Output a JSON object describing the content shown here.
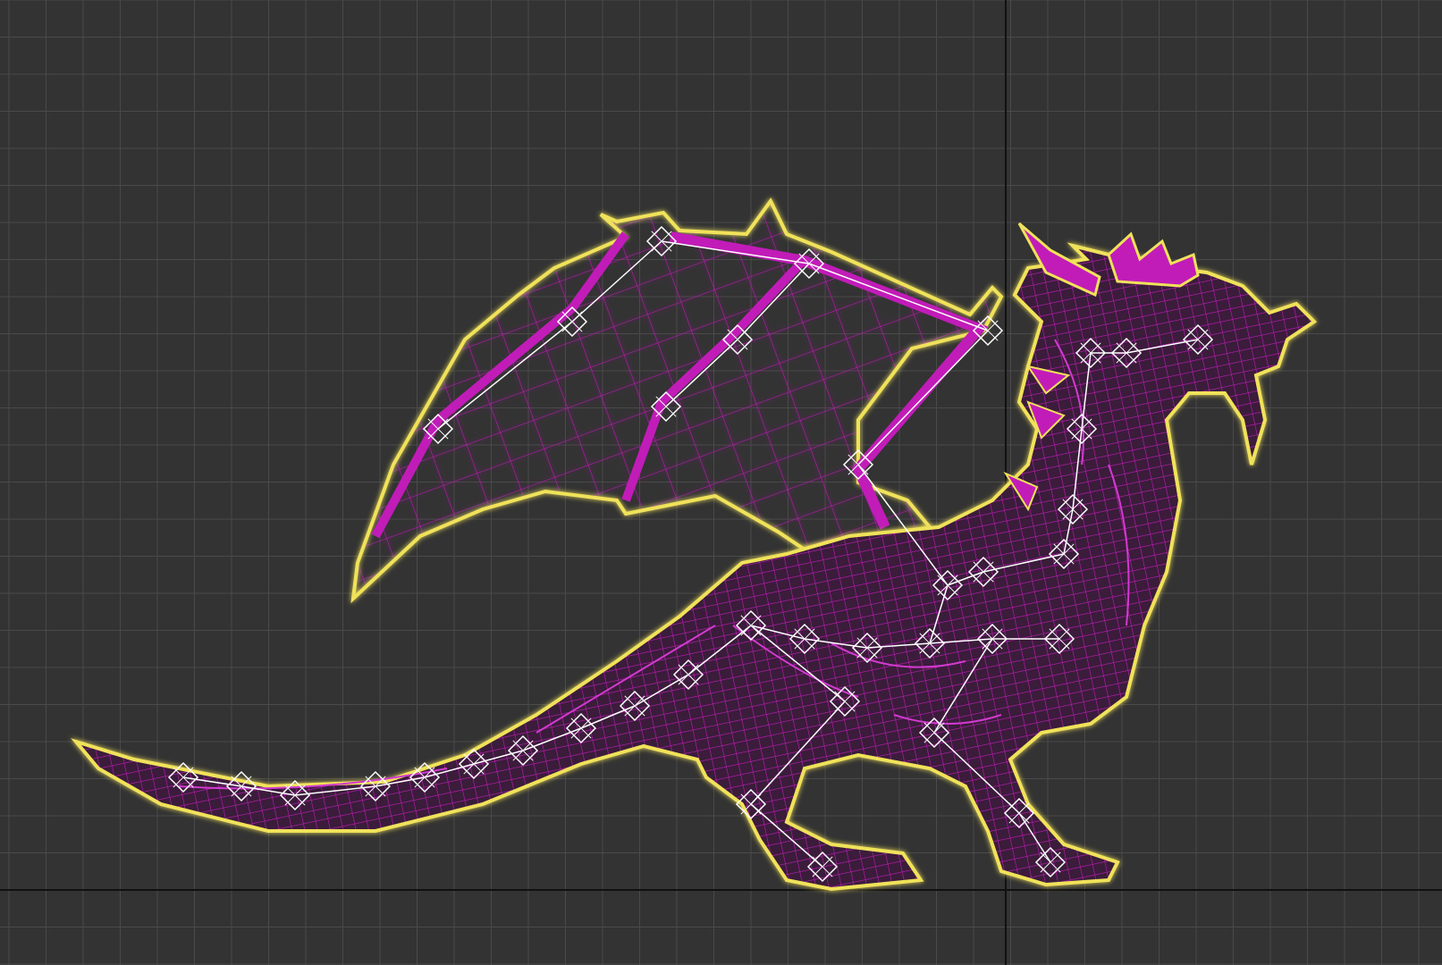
{
  "viewport": {
    "background_color": "#333333",
    "grid_line_color": "#4a4a4a",
    "world_axis_color": "#111111"
  },
  "model": {
    "subject": "dragon",
    "display_mode": "wireframe",
    "wire_color": "#c11cb8",
    "selection_outline_color": "#f0e25a",
    "bone_color": "#ffffff",
    "selected": true
  }
}
